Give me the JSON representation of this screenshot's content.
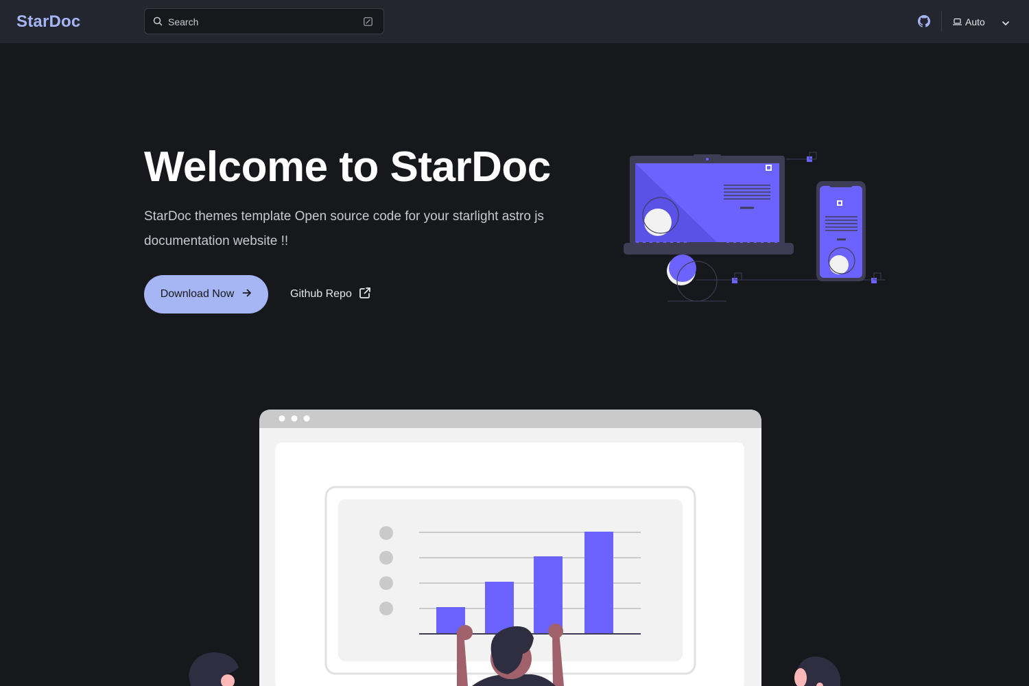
{
  "header": {
    "logo": "StarDoc",
    "search": {
      "label": "Search",
      "icon": "search-icon",
      "shortcut_icon": "keyboard-shortcut-icon"
    },
    "github_icon": "github-icon",
    "theme_select": {
      "icon": "laptop-icon",
      "value": "Auto",
      "chevron": "chevron-down-icon"
    }
  },
  "hero": {
    "title": "Welcome to StarDoc",
    "tagline": "StarDoc themes template Open source code for your starlight astro js documentation website !!",
    "primary_action": {
      "label": "Download Now",
      "icon": "arrow-right-icon"
    },
    "secondary_action": {
      "label": "Github Repo",
      "icon": "external-link-icon"
    }
  },
  "colors": {
    "background": "#17181c",
    "header_bg": "#23252f",
    "accent": "#a6b6f5",
    "illustration_purple": "#6c63ff"
  }
}
